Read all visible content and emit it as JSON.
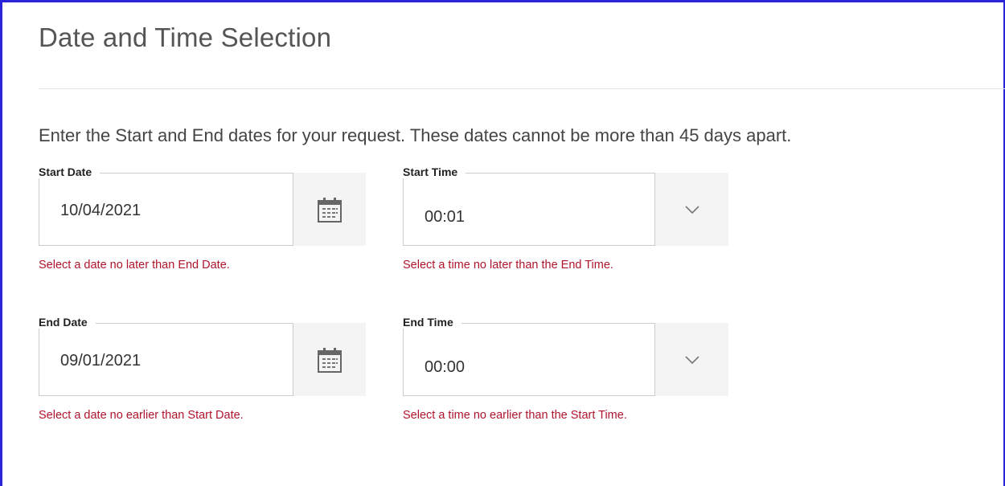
{
  "page": {
    "title": "Date and Time Selection",
    "instructions": "Enter the Start and End dates for your request. These dates cannot be more than 45 days apart."
  },
  "start_date": {
    "label": "Start Date",
    "value": "10/04/2021",
    "error": "Select a date no later than End Date.",
    "icon": "calendar-icon"
  },
  "start_time": {
    "label": "Start Time",
    "value": "00:01",
    "error": "Select a time no later than the End Time.",
    "icon": "chevron-down-icon"
  },
  "end_date": {
    "label": "End Date",
    "value": "09/01/2021",
    "error": "Select a date no earlier than Start Date.",
    "icon": "calendar-icon"
  },
  "end_time": {
    "label": "End Time",
    "value": "00:00",
    "error": "Select a time no earlier than the Start Time.",
    "icon": "chevron-down-icon"
  },
  "colors": {
    "frame_border": "#2a24d8",
    "error_text": "#b0142c",
    "field_border": "#cccccc",
    "button_bg": "#f4f4f4"
  }
}
